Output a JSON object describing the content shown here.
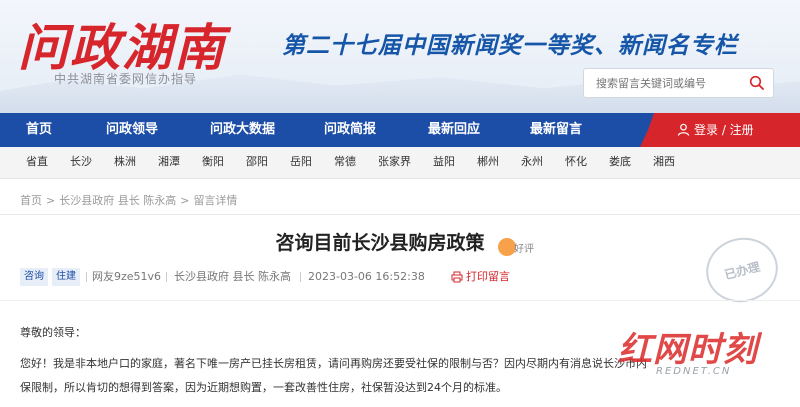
{
  "header": {
    "logo": "问政湖南",
    "logo_sub": "中共湖南省委网信办指导",
    "award": "第二十七届中国新闻奖一等奖、新闻名专栏",
    "search_placeholder": "搜索留言关键词或编号"
  },
  "nav": {
    "items": [
      "首页",
      "问政领导",
      "问政大数据",
      "问政简报",
      "最新回应",
      "最新留言"
    ],
    "login": "登录 / 注册"
  },
  "cities": [
    "省直",
    "长沙",
    "株洲",
    "湘潭",
    "衡阳",
    "邵阳",
    "岳阳",
    "常德",
    "张家界",
    "益阳",
    "郴州",
    "永州",
    "怀化",
    "娄底",
    "湘西"
  ],
  "breadcrumb": [
    "首页",
    "长沙县政府 县长 陈永高",
    "留言详情"
  ],
  "post": {
    "title": "咨询目前长沙县购房政策",
    "good_label": "好评",
    "tags": [
      "咨询",
      "住建"
    ],
    "author": "网友9ze51v6",
    "target": "长沙县政府 县长 陈永高",
    "datetime": "2023-03-06 16:52:38",
    "print_label": "打印留言",
    "stamp": "已办理",
    "greeting": "尊敬的领导：",
    "body_line1": "您好！我是非本地户口的家庭，著名下唯一房产已挂长房租赁，请问再购房还要受社保的限制与否？因内尽期内有消息说长沙市内",
    "body_line2": "保限制，所以肯切的想得到答案，因为近期想购置，一套改善性住房，社保暂没达到24个月的标准。"
  },
  "watermark": {
    "main": "红网时刻",
    "sub": "REDNET.CN"
  }
}
